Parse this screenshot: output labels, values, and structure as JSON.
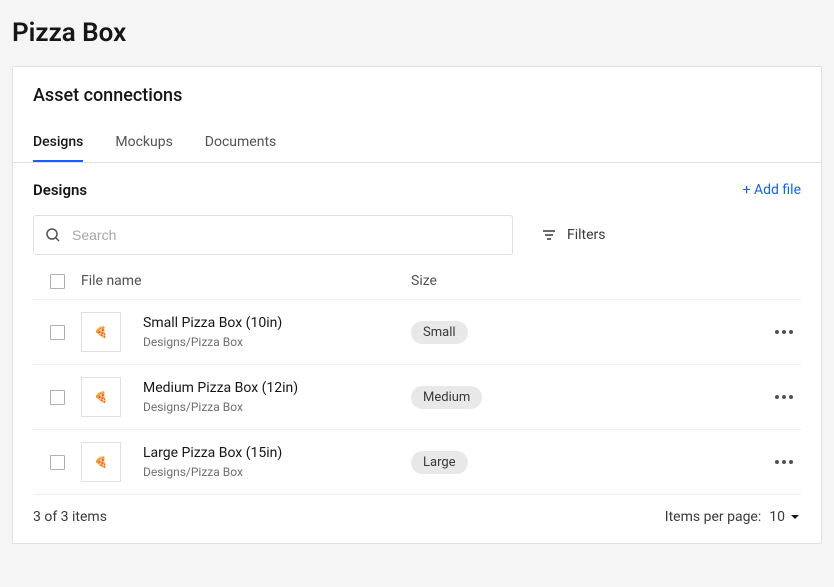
{
  "page_title": "Pizza Box",
  "card": {
    "title": "Asset connections",
    "tabs": [
      {
        "label": "Designs",
        "active": true
      },
      {
        "label": "Mockups",
        "active": false
      },
      {
        "label": "Documents",
        "active": false
      }
    ]
  },
  "section": {
    "title": "Designs",
    "add_file_label": "+ Add file"
  },
  "search": {
    "placeholder": "Search"
  },
  "filters_label": "Filters",
  "table": {
    "headers": {
      "file_name": "File name",
      "size": "Size"
    },
    "rows": [
      {
        "name": "Small Pizza Box (10in)",
        "path": "Designs/Pizza Box",
        "size": "Small"
      },
      {
        "name": "Medium Pizza Box (12in)",
        "path": "Designs/Pizza Box",
        "size": "Medium"
      },
      {
        "name": "Large Pizza Box (15in)",
        "path": "Designs/Pizza Box",
        "size": "Large"
      }
    ]
  },
  "footer": {
    "count_text": "3 of 3 items",
    "per_page_label": "Items per page:",
    "per_page_value": "10"
  }
}
